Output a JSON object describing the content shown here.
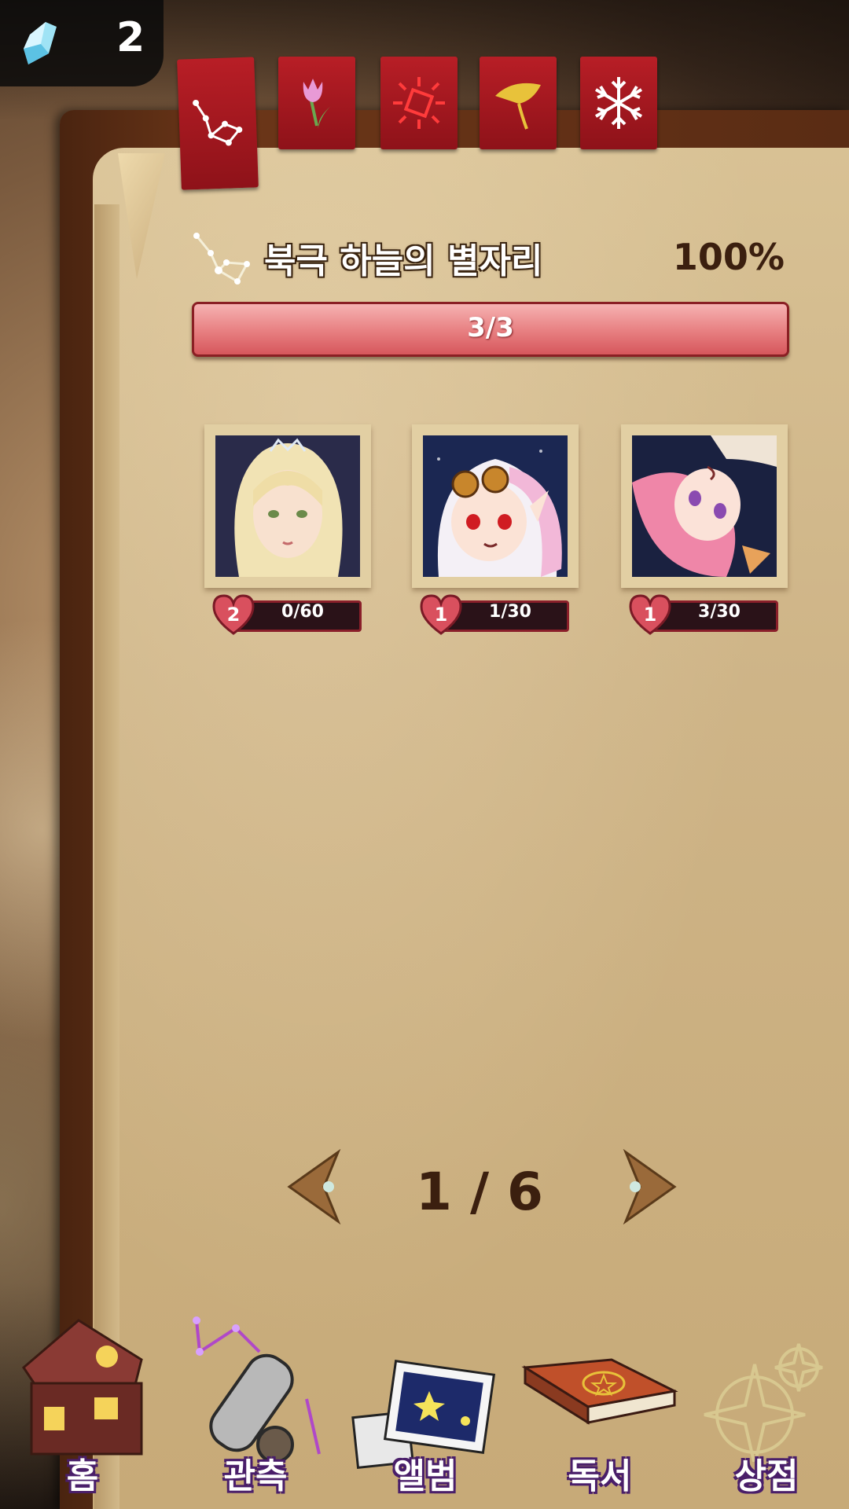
{
  "currency": {
    "icon": "crystal-gem-icon",
    "value": "2"
  },
  "tabs": [
    {
      "icon": "constellation-icon",
      "active": true
    },
    {
      "icon": "tulip-icon",
      "active": false
    },
    {
      "icon": "sun-icon",
      "active": false
    },
    {
      "icon": "ginkgo-leaf-icon",
      "active": false
    },
    {
      "icon": "snowflake-icon",
      "active": false
    }
  ],
  "header": {
    "icon": "constellation-icon",
    "title": "북극 하늘의 별자리",
    "percent": "100%"
  },
  "progress": {
    "label": "3/3",
    "fraction": 1.0
  },
  "cards": [
    {
      "portrait": "blonde-princess-portrait",
      "level": "2",
      "progress": "0/60"
    },
    {
      "portrait": "white-hair-goggles-girl-portrait",
      "level": "1",
      "progress": "1/30"
    },
    {
      "portrait": "pink-hair-girl-portrait",
      "level": "1",
      "progress": "3/30"
    }
  ],
  "pagination": {
    "label": "1 / 6"
  },
  "nav": [
    {
      "icon": "house-icon",
      "label": "홈"
    },
    {
      "icon": "telescope-icon",
      "label": "관측"
    },
    {
      "icon": "photo-album-icon",
      "label": "앨범"
    },
    {
      "icon": "spell-book-icon",
      "label": "독서"
    },
    {
      "icon": "compass-star-icon",
      "label": "상점"
    }
  ],
  "colors": {
    "tab_red": "#a5181f",
    "accent_pink": "#e77e80",
    "text_brown": "#3b1f0f",
    "nav_outline": "#4a1f6a"
  }
}
